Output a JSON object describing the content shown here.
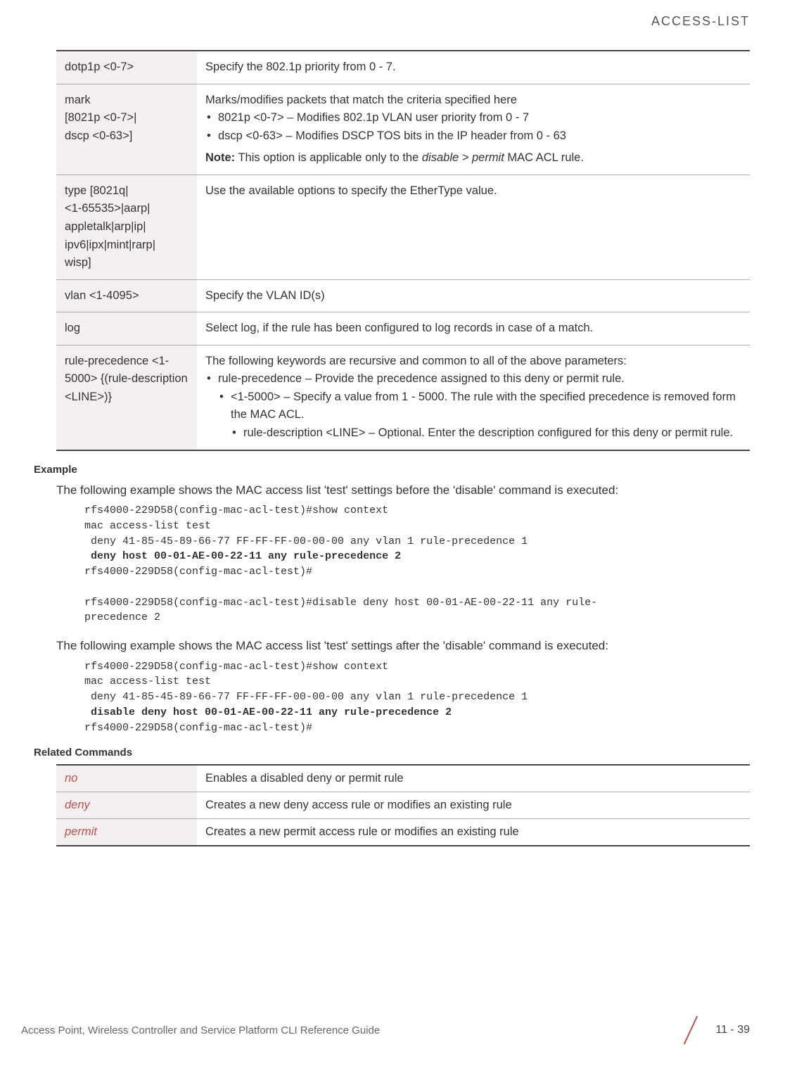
{
  "header": {
    "title": "ACCESS-LIST"
  },
  "params_table": {
    "rows": [
      {
        "param": "dotp1p <0-7>",
        "desc_plain": "Specify the 802.1p priority from 0 - 7."
      },
      {
        "param": "mark\n [8021p <0-7>|\ndscp <0-63>]",
        "desc_lead": "Marks/modifies packets that match the criteria specified here",
        "bullets": [
          "8021p <0-7> – Modifies 802.1p VLAN user priority from 0 - 7",
          "dscp <0-63> – Modifies DSCP TOS bits in the IP header from 0 - 63"
        ],
        "note_label": "Note:",
        "note_text_pre": " This option is applicable only to the ",
        "note_italic": "disable > permit",
        "note_text_post": " MAC ACL rule."
      },
      {
        "param": "type [8021q|\n<1-65535>|aarp|\nappletalk|arp|ip|\nipv6|ipx|mint|rarp|\nwisp]",
        "desc_plain": "Use the available options to specify the EtherType value."
      },
      {
        "param": "vlan <1-4095>",
        "desc_plain": "Specify the VLAN ID(s)"
      },
      {
        "param": "log",
        "desc_plain": "Select log, if the rule has been configured to log records in case of a match."
      },
      {
        "param": "rule-precedence <1-5000> {(rule-description <LINE>)}",
        "desc_lead": "The following keywords are recursive and common to all of the above parameters:",
        "bullets_nested": {
          "l1": "rule-precedence – Provide the precedence assigned to this deny or permit rule.",
          "l2_pre": "<1-5000> – Specify a value from 1 - 5000. The rule with the specified precedence is removed form the MAC ACL.",
          "l3": "rule-description <LINE> – Optional. Enter the description configured for this deny or permit rule."
        }
      }
    ]
  },
  "example": {
    "heading": "Example",
    "intro1": "The following example shows the MAC access list 'test' settings before the 'disable' command is executed:",
    "code1_l1": "rfs4000-229D58(config-mac-acl-test)#show context",
    "code1_l2": "mac access-list test",
    "code1_l3": " deny 41-85-45-89-66-77 FF-FF-FF-00-00-00 any vlan 1 rule-precedence 1",
    "code1_l4": " deny host 00-01-AE-00-22-11 any rule-precedence 2",
    "code1_l5": "rfs4000-229D58(config-mac-acl-test)#",
    "code1_l6": "rfs4000-229D58(config-mac-acl-test)#disable deny host 00-01-AE-00-22-11 any rule-",
    "code1_l7": "precedence 2",
    "intro2": "The following example shows the MAC access list 'test' settings after the 'disable' command is executed:",
    "code2_l1": "rfs4000-229D58(config-mac-acl-test)#show context",
    "code2_l2": "mac access-list test",
    "code2_l3": " deny 41-85-45-89-66-77 FF-FF-FF-00-00-00 any vlan 1 rule-precedence 1",
    "code2_l4": " disable deny host 00-01-AE-00-22-11 any rule-precedence 2",
    "code2_l5": "rfs4000-229D58(config-mac-acl-test)#"
  },
  "related": {
    "heading": "Related Commands",
    "rows": [
      {
        "cmd": "no",
        "desc": "Enables a disabled deny or permit rule"
      },
      {
        "cmd": "deny",
        "desc": "Creates a new deny access rule or modifies an existing rule"
      },
      {
        "cmd": "permit",
        "desc": "Creates a new permit access rule or modifies an existing rule"
      }
    ]
  },
  "footer": {
    "text": "Access Point, Wireless Controller and Service Platform CLI Reference Guide",
    "page": "11 - 39"
  }
}
